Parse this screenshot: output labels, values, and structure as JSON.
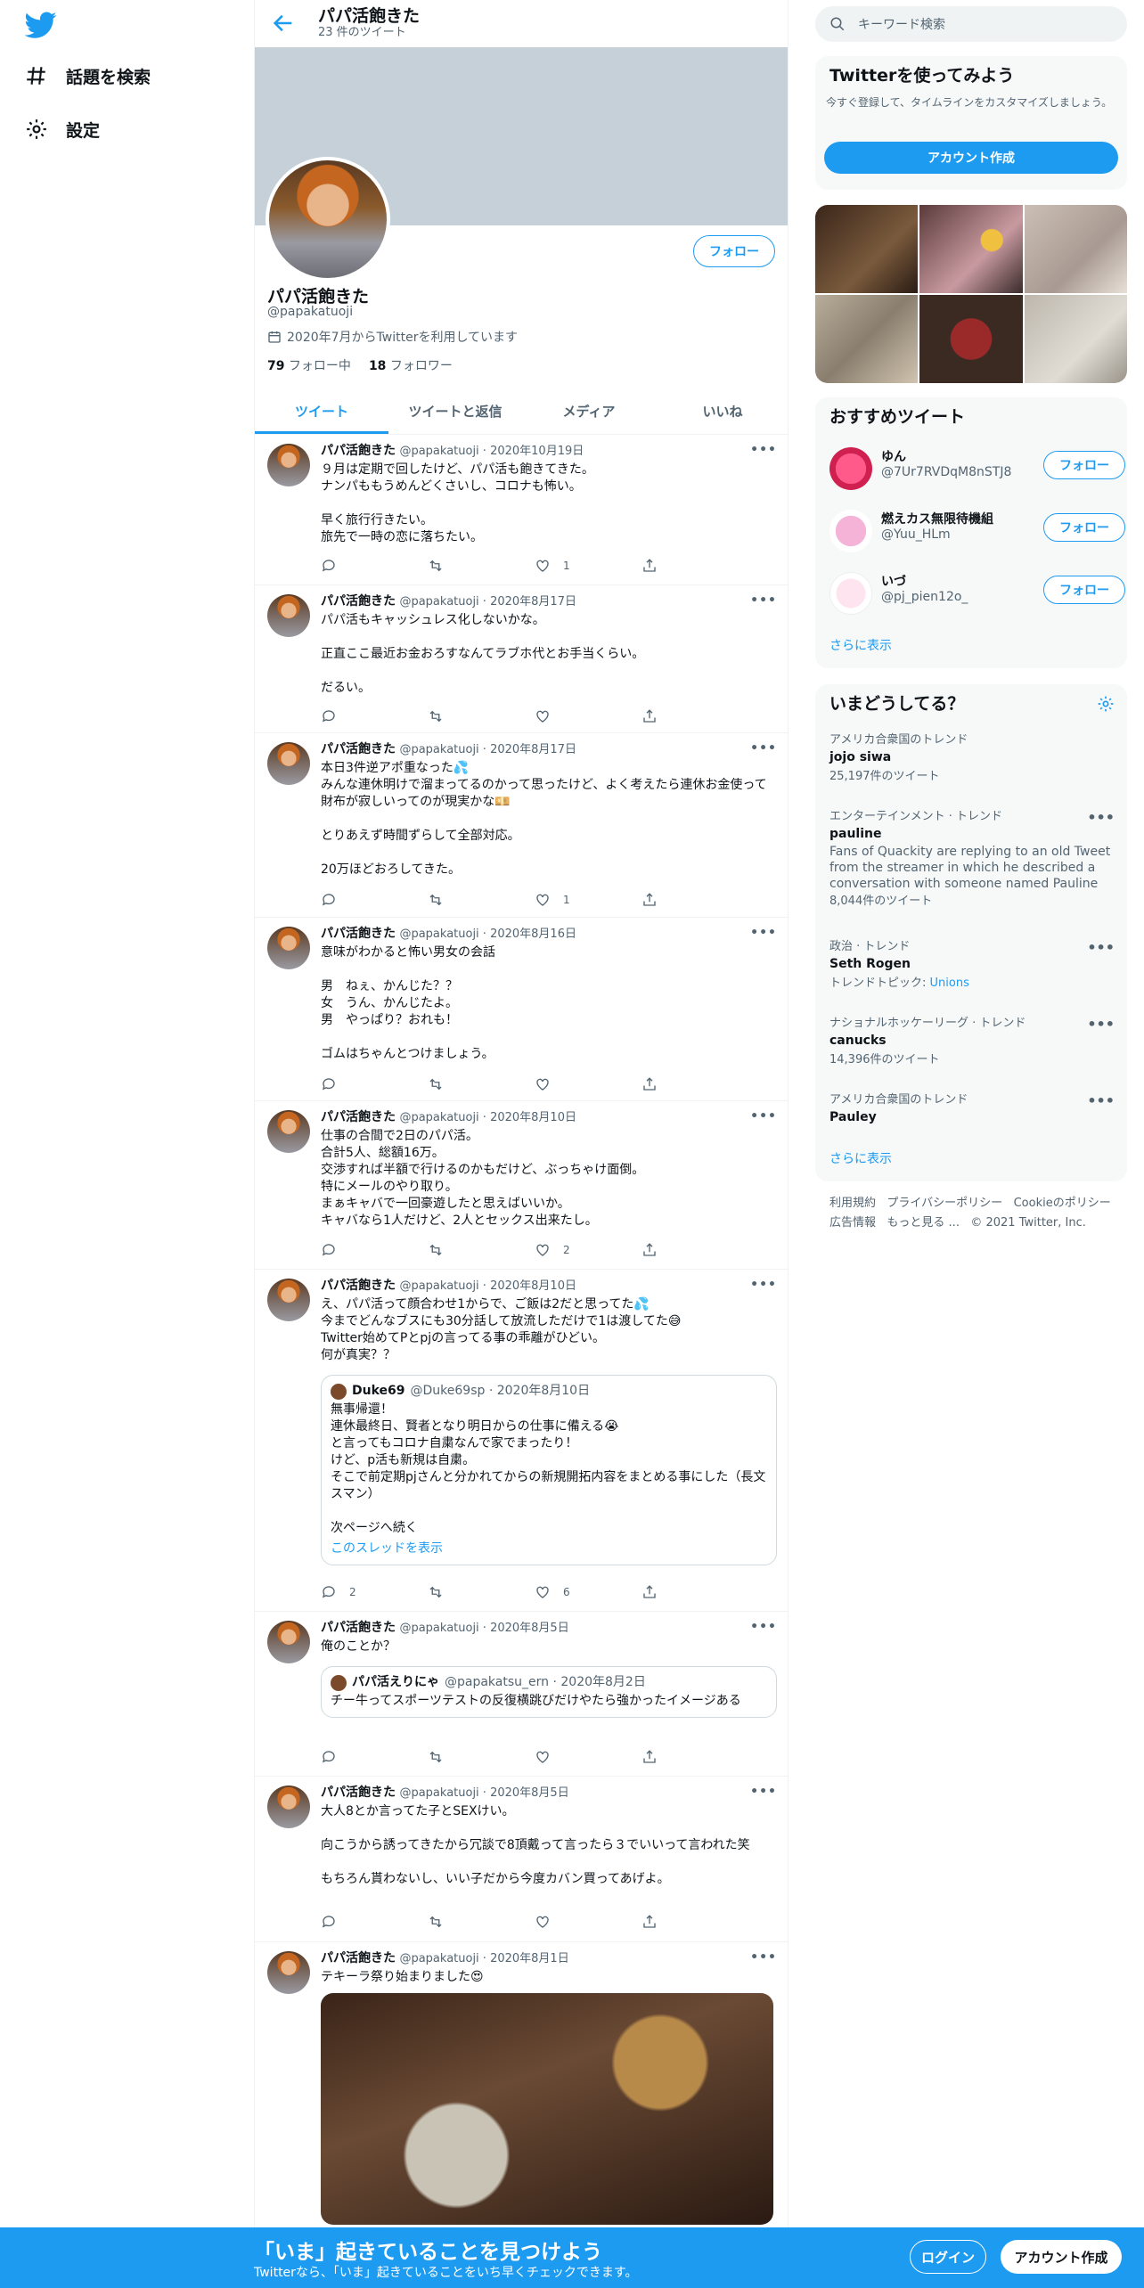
{
  "nav": {
    "explore": "話題を検索",
    "settings": "設定"
  },
  "header": {
    "name": "パパ活飽きた",
    "tweet_count": "23 件のツイート"
  },
  "profile": {
    "name": "パパ活飽きた",
    "handle": "@papakatuoji",
    "joined": "2020年7月からTwitterを利用しています",
    "following_count": "79",
    "following_label": "フォロー中",
    "followers_count": "18",
    "followers_label": "フォロワー",
    "follow_label": "フォロー"
  },
  "tabs": [
    "ツイート",
    "ツイートと返信",
    "メディア",
    "いいね"
  ],
  "tweets": [
    {
      "name": "パパ活飽きた",
      "meta": "@papakatuoji · 2020年10月19日",
      "text": "９月は定期で回したけど、パパ活も飽きてきた。\nナンパももうめんどくさいし、コロナも怖い。\n\n早く旅行行きたい。\n旅先で一時の恋に落ちたい。",
      "reply": "",
      "retweet": "",
      "like": "1"
    },
    {
      "name": "パパ活飽きた",
      "meta": "@papakatuoji · 2020年8月17日",
      "text": "パパ活もキャッシュレス化しないかな。\n\n正直ここ最近お金おろすなんてラブホ代とお手当くらい。\n\nだるい。",
      "reply": "",
      "retweet": "",
      "like": ""
    },
    {
      "name": "パパ活飽きた",
      "meta": "@papakatuoji · 2020年8月17日",
      "text": "本日3件逆アポ重なった💦\nみんな連休明けで溜まってるのかって思ったけど、よく考えたら連休お金使って財布が寂しいってのが現実かな💴\n\nとりあえず時間ずらして全部対応。\n\n20万ほどおろしてきた。",
      "reply": "",
      "retweet": "",
      "like": "1"
    },
    {
      "name": "パパ活飽きた",
      "meta": "@papakatuoji · 2020年8月16日",
      "text": "意味がわかると怖い男女の会話\n\n男　ねぇ、かんじた？？\n女　うん、かんじたよ。\n男　やっぱり？おれも！\n\nゴムはちゃんとつけましょう。",
      "reply": "",
      "retweet": "",
      "like": ""
    },
    {
      "name": "パパ活飽きた",
      "meta": "@papakatuoji · 2020年8月10日",
      "text": "仕事の合間で2日のパパ活。\n合計5人、総額16万。\n交渉すれば半額で行けるのかもだけど、ぶっちゃけ面倒。\n特にメールのやり取り。\nまぁキャバで一回豪遊したと思えばいいか。\nキャバなら1人だけど、2人とセックス出来たし。",
      "reply": "",
      "retweet": "",
      "like": "2"
    },
    {
      "name": "パパ活飽きた",
      "meta": "@papakatuoji · 2020年8月10日",
      "text": "え、パパ活って顔合わせ1からで、ご飯は2だと思ってた💦\n今までどんなブスにも30分話して放流しただけで1は渡してた😅\nTwitter始めてPとpjの言ってる事の乖離がひどい。\n何が真実？？",
      "reply": "2",
      "retweet": "",
      "like": "6",
      "quote": {
        "name": "Duke69",
        "meta": "@Duke69sp · 2020年8月10日",
        "text": "無事帰還！\n連休最終日、賢者となり明日からの仕事に備える😭\nと言ってもコロナ自粛なんで家でまったり！\nけど、p活も新規は自粛。\nそこで前定期pjさんと分かれてからの新規開拓内容をまとめる事にした（長文スマン）\n\n次ページへ続く",
        "thread_link": "このスレッドを表示"
      }
    },
    {
      "name": "パパ活飽きた",
      "meta": "@papakatuoji · 2020年8月5日",
      "text": "俺のことか？",
      "reply": "",
      "retweet": "",
      "like": "",
      "quote": {
        "name": "パパ活えりにゃ",
        "meta": "@papakatsu_ern · 2020年8月2日",
        "text": "チー牛ってスポーツテストの反復横跳びだけやたら強かったイメージある"
      }
    },
    {
      "name": "パパ活飽きた",
      "meta": "@papakatuoji · 2020年8月5日",
      "text": "大人8とか言ってた子とSEXけい。\n\n向こうから誘ってきたから冗談で8頂戴って言ったら３でいいって言われた笑\n\nもちろん貰わないし、いい子だから今度カバン買ってあげよ。",
      "reply": "",
      "retweet": "",
      "like": ""
    },
    {
      "name": "パパ活飽きた",
      "meta": "@papakatuoji · 2020年8月1日",
      "text": "テキーラ祭り始まりました😍",
      "reply": "",
      "retweet": "",
      "like": ""
    }
  ],
  "right": {
    "search_placeholder": "キーワード検索",
    "join_title": "Twitterを使ってみよう",
    "join_desc": "今すぐ登録して、タイムラインをカスタマイズしましょう。",
    "join_button": "アカウント作成",
    "who_title": "おすすめツイート",
    "who": [
      {
        "name": "ゆん",
        "handle": "@7Ur7RVDqM8nSTJ8",
        "button": "フォロー"
      },
      {
        "name": "燃えカス無限待機組",
        "handle": "@Yuu_HLm",
        "button": "フォロー"
      },
      {
        "name": "いづ",
        "handle": "@pj_pien12o_",
        "button": "フォロー"
      }
    ],
    "show_more": "さらに表示",
    "trends_title": "いまどうしてる？",
    "trends": [
      {
        "context": "アメリカ合衆国のトレンド",
        "name": "jojo siwa",
        "count": "25,197件のツイート"
      },
      {
        "context": "エンターテインメント · トレンド",
        "name": "pauline",
        "desc": "Fans of Quackity are replying to an old Tweet from the streamer in which he described a conversation with someone named Pauline",
        "count": "8,044件のツイート"
      },
      {
        "context": "政治 · トレンド",
        "name": "Seth Rogen",
        "topic_label": "トレンドトピック:",
        "topic": "Unions"
      },
      {
        "context": "ナショナルホッケーリーグ · トレンド",
        "name": "canucks",
        "count": "14,396件のツイート"
      },
      {
        "context": "アメリカ合衆国のトレンド",
        "name": "Pauley"
      }
    ],
    "trends_more": "さらに表示",
    "footer": {
      "terms": "利用規約",
      "privacy": "プライバシーポリシー",
      "cookie": "Cookieのポリシー",
      "ads": "広告情報",
      "more": "もっと見る ...",
      "copyright": "© 2021 Twitter, Inc."
    }
  },
  "bottom": {
    "title": "「いま」起きていることを見つけよう",
    "subtitle": "Twitterなら、「いま」起きていることをいち早くチェックできます。",
    "login": "ログイン",
    "signup": "アカウント作成"
  },
  "colors": {
    "accent": "#1d9bf0",
    "banner": "#c5d0d8"
  }
}
